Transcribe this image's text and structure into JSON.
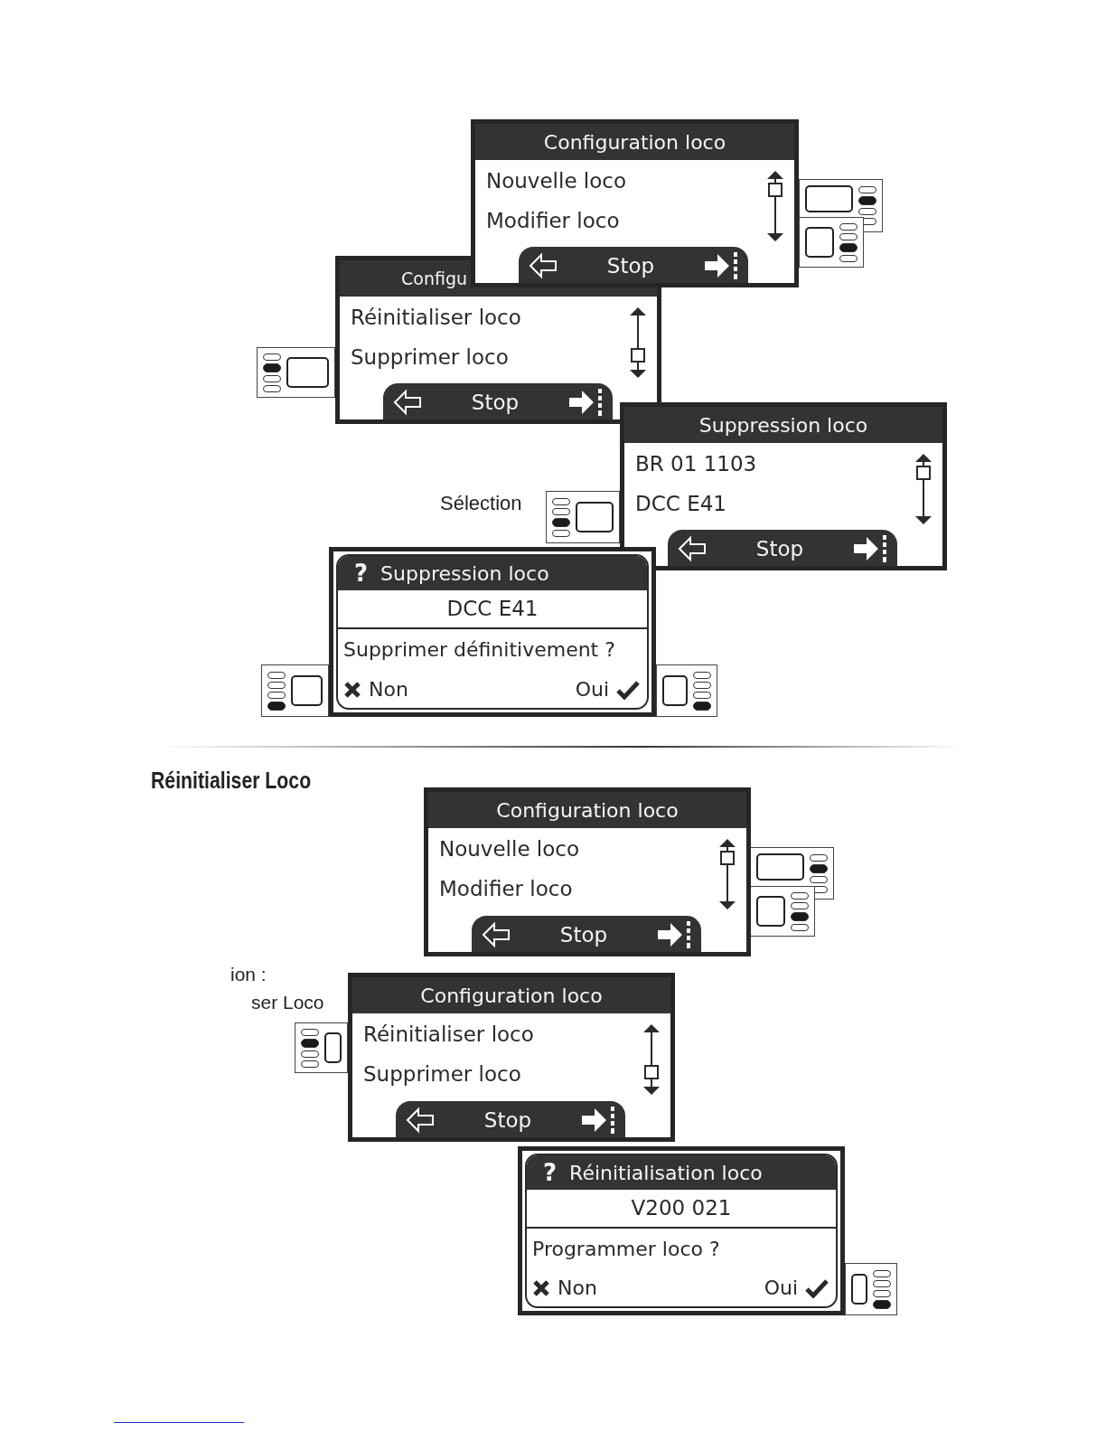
{
  "screens": [
    {
      "kind": "menu",
      "title": "Configuration loco",
      "items": [
        "Nouvelle loco",
        "Modifier loco"
      ],
      "scrolled_down": false,
      "footer": "Stop"
    },
    {
      "kind": "menu",
      "title": "Configu",
      "items": [
        "Réinitialiser loco",
        "Supprimer loco"
      ],
      "scrolled_down": true,
      "footer": "Stop"
    },
    {
      "kind": "menu",
      "title": "Suppression loco",
      "items": [
        "BR 01 1103",
        "DCC E41"
      ],
      "scrolled_down": false,
      "footer": "Stop"
    },
    {
      "kind": "confirm",
      "mark": "?",
      "title": "Suppression loco",
      "name": "DCC E41",
      "question": "Supprimer définitivement ?",
      "no": "Non",
      "yes": "Oui"
    },
    {
      "kind": "menu",
      "title": "Configuration loco",
      "items": [
        "Nouvelle loco",
        "Modifier loco"
      ],
      "scrolled_down": false,
      "footer": "Stop"
    },
    {
      "kind": "menu",
      "title": "Configuration loco",
      "items": [
        "Réinitialiser loco",
        "Supprimer loco"
      ],
      "scrolled_down": true,
      "footer": "Stop"
    },
    {
      "kind": "confirm",
      "mark": "?",
      "title": "Réinitialisation loco",
      "name": "V200 021",
      "question": "Programmer loco ?",
      "no": "Non",
      "yes": "Oui"
    }
  ],
  "keypads": [
    {
      "leds_left": false,
      "keys": [
        {
          "selected": false
        },
        {
          "selected": true
        },
        {
          "selected": false
        },
        {
          "selected": false
        }
      ]
    },
    {
      "leds_left": false,
      "keys": [
        {
          "selected": false
        },
        {
          "selected": false
        },
        {
          "selected": true
        },
        {
          "selected": false
        }
      ]
    },
    {
      "leds_left": true,
      "keys": [
        {
          "selected": false
        },
        {
          "selected": true
        },
        {
          "selected": false
        },
        {
          "selected": false
        }
      ]
    },
    {
      "leds_left": true,
      "keys": [
        {
          "selected": false
        },
        {
          "selected": false
        },
        {
          "selected": true
        },
        {
          "selected": false
        }
      ]
    },
    {
      "leds_left": true,
      "keys": [
        {
          "selected": false
        },
        {
          "selected": false
        },
        {
          "selected": false
        },
        {
          "selected": true
        }
      ]
    },
    {
      "leds_left": false,
      "keys": [
        {
          "selected": false
        },
        {
          "selected": false
        },
        {
          "selected": false
        },
        {
          "selected": true
        }
      ]
    },
    {
      "leds_left": false,
      "keys": [
        {
          "selected": false
        },
        {
          "selected": true
        },
        {
          "selected": false
        },
        {
          "selected": false
        }
      ]
    },
    {
      "leds_left": false,
      "keys": [
        {
          "selected": false
        },
        {
          "selected": false
        },
        {
          "selected": true
        },
        {
          "selected": false
        }
      ]
    },
    {
      "leds_left": true,
      "keys": [
        {
          "selected": false
        },
        {
          "selected": true
        },
        {
          "selected": false
        },
        {
          "selected": false
        }
      ]
    },
    {
      "leds_left": false,
      "keys": [
        {
          "selected": false
        },
        {
          "selected": false
        },
        {
          "selected": false
        },
        {
          "selected": true
        }
      ]
    }
  ],
  "labels": [
    "Sélection",
    "ion :",
    "ser Loco"
  ],
  "heading": "Réinitialiser Loco"
}
